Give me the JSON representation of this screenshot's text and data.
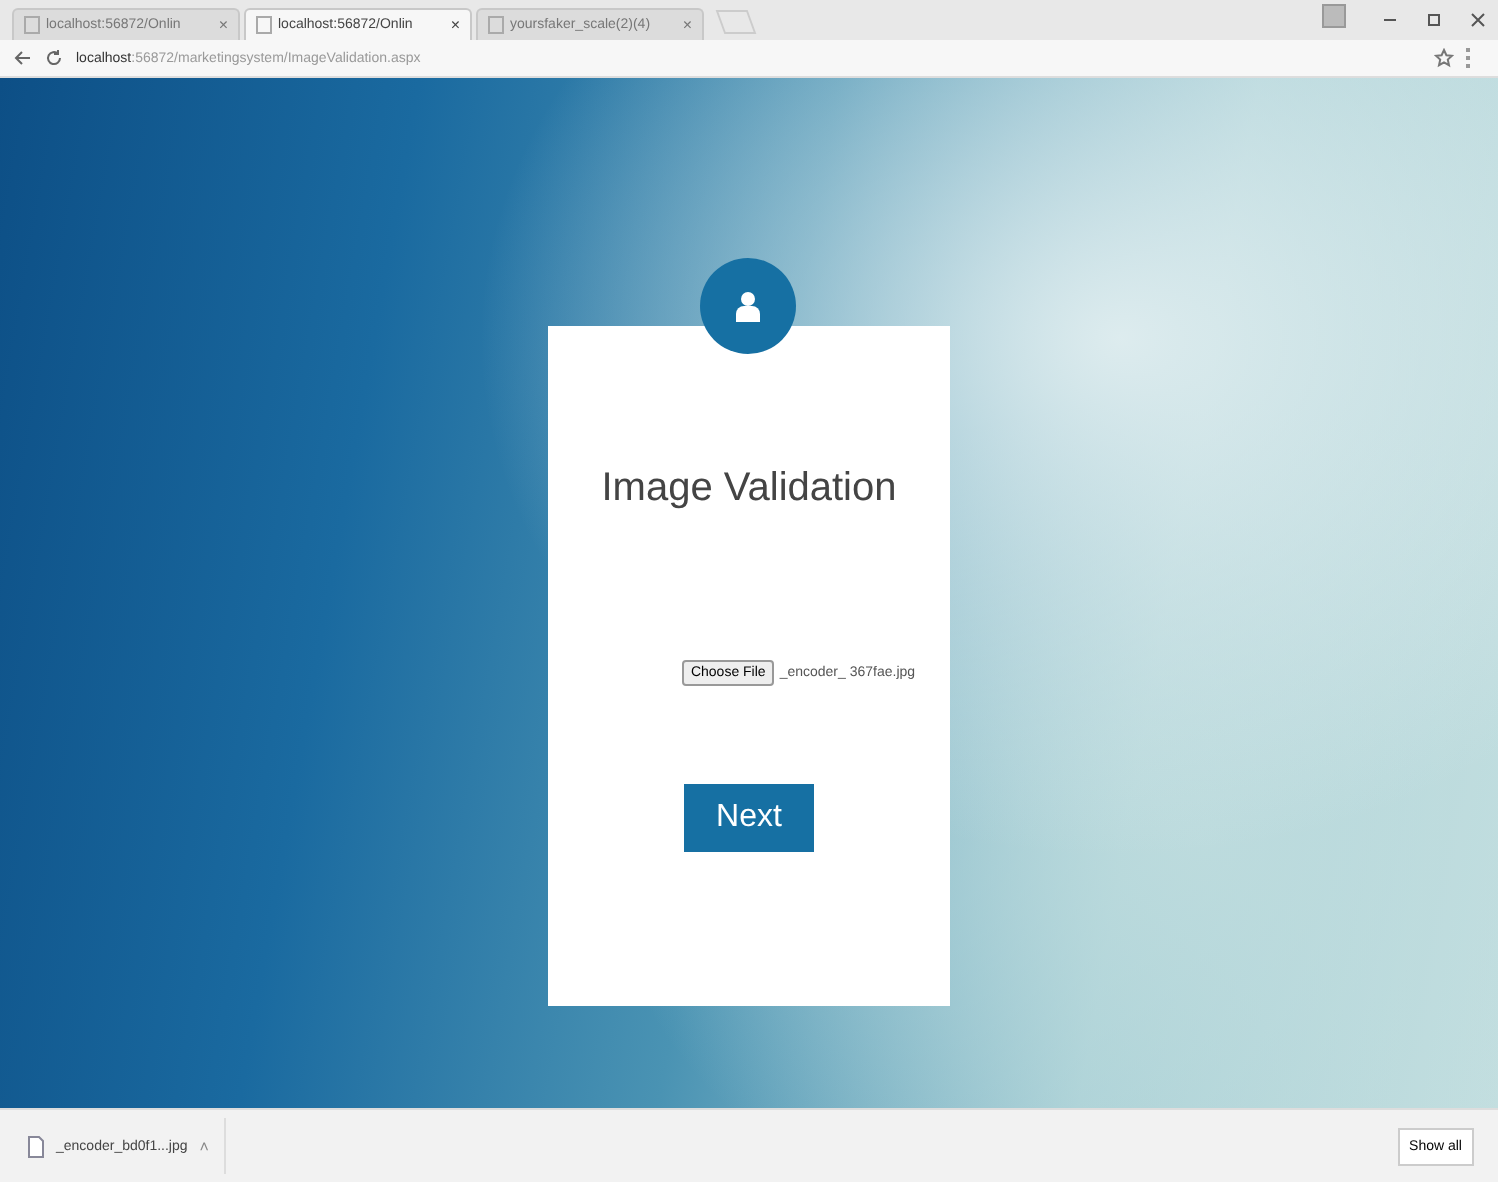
{
  "browser": {
    "tabs": [
      {
        "title": "localhost:56872/Onlin",
        "close": "×",
        "selected": false
      },
      {
        "title": "localhost:56872/Onlin",
        "close": "×",
        "selected": true
      },
      {
        "title": "yoursfaker_scale(2)(4)",
        "close": "×",
        "selected": false
      }
    ],
    "address": {
      "host": "localhost",
      "path": ":56872/marketingsystem/ImageValidation.aspx"
    }
  },
  "card": {
    "title": "Image Validation",
    "file_button": "Choose File",
    "file_name": "_encoder_ 367fae.jpg",
    "submit": "Next"
  },
  "downloads": {
    "items": [
      {
        "name": "_encoder_bd0f1...jpg",
        "caret": "˄"
      }
    ],
    "show_all": "Show all"
  }
}
